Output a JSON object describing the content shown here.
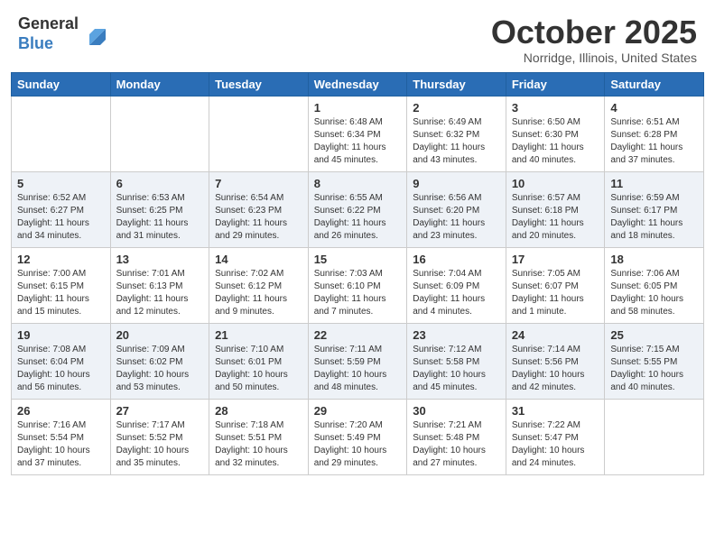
{
  "header": {
    "logo_line1": "General",
    "logo_line2": "Blue",
    "month": "October 2025",
    "location": "Norridge, Illinois, United States"
  },
  "days_of_week": [
    "Sunday",
    "Monday",
    "Tuesday",
    "Wednesday",
    "Thursday",
    "Friday",
    "Saturday"
  ],
  "weeks": [
    {
      "shaded": false,
      "days": [
        {
          "num": "",
          "info": ""
        },
        {
          "num": "",
          "info": ""
        },
        {
          "num": "",
          "info": ""
        },
        {
          "num": "1",
          "info": "Sunrise: 6:48 AM\nSunset: 6:34 PM\nDaylight: 11 hours and 45 minutes."
        },
        {
          "num": "2",
          "info": "Sunrise: 6:49 AM\nSunset: 6:32 PM\nDaylight: 11 hours and 43 minutes."
        },
        {
          "num": "3",
          "info": "Sunrise: 6:50 AM\nSunset: 6:30 PM\nDaylight: 11 hours and 40 minutes."
        },
        {
          "num": "4",
          "info": "Sunrise: 6:51 AM\nSunset: 6:28 PM\nDaylight: 11 hours and 37 minutes."
        }
      ]
    },
    {
      "shaded": true,
      "days": [
        {
          "num": "5",
          "info": "Sunrise: 6:52 AM\nSunset: 6:27 PM\nDaylight: 11 hours and 34 minutes."
        },
        {
          "num": "6",
          "info": "Sunrise: 6:53 AM\nSunset: 6:25 PM\nDaylight: 11 hours and 31 minutes."
        },
        {
          "num": "7",
          "info": "Sunrise: 6:54 AM\nSunset: 6:23 PM\nDaylight: 11 hours and 29 minutes."
        },
        {
          "num": "8",
          "info": "Sunrise: 6:55 AM\nSunset: 6:22 PM\nDaylight: 11 hours and 26 minutes."
        },
        {
          "num": "9",
          "info": "Sunrise: 6:56 AM\nSunset: 6:20 PM\nDaylight: 11 hours and 23 minutes."
        },
        {
          "num": "10",
          "info": "Sunrise: 6:57 AM\nSunset: 6:18 PM\nDaylight: 11 hours and 20 minutes."
        },
        {
          "num": "11",
          "info": "Sunrise: 6:59 AM\nSunset: 6:17 PM\nDaylight: 11 hours and 18 minutes."
        }
      ]
    },
    {
      "shaded": false,
      "days": [
        {
          "num": "12",
          "info": "Sunrise: 7:00 AM\nSunset: 6:15 PM\nDaylight: 11 hours and 15 minutes."
        },
        {
          "num": "13",
          "info": "Sunrise: 7:01 AM\nSunset: 6:13 PM\nDaylight: 11 hours and 12 minutes."
        },
        {
          "num": "14",
          "info": "Sunrise: 7:02 AM\nSunset: 6:12 PM\nDaylight: 11 hours and 9 minutes."
        },
        {
          "num": "15",
          "info": "Sunrise: 7:03 AM\nSunset: 6:10 PM\nDaylight: 11 hours and 7 minutes."
        },
        {
          "num": "16",
          "info": "Sunrise: 7:04 AM\nSunset: 6:09 PM\nDaylight: 11 hours and 4 minutes."
        },
        {
          "num": "17",
          "info": "Sunrise: 7:05 AM\nSunset: 6:07 PM\nDaylight: 11 hours and 1 minute."
        },
        {
          "num": "18",
          "info": "Sunrise: 7:06 AM\nSunset: 6:05 PM\nDaylight: 10 hours and 58 minutes."
        }
      ]
    },
    {
      "shaded": true,
      "days": [
        {
          "num": "19",
          "info": "Sunrise: 7:08 AM\nSunset: 6:04 PM\nDaylight: 10 hours and 56 minutes."
        },
        {
          "num": "20",
          "info": "Sunrise: 7:09 AM\nSunset: 6:02 PM\nDaylight: 10 hours and 53 minutes."
        },
        {
          "num": "21",
          "info": "Sunrise: 7:10 AM\nSunset: 6:01 PM\nDaylight: 10 hours and 50 minutes."
        },
        {
          "num": "22",
          "info": "Sunrise: 7:11 AM\nSunset: 5:59 PM\nDaylight: 10 hours and 48 minutes."
        },
        {
          "num": "23",
          "info": "Sunrise: 7:12 AM\nSunset: 5:58 PM\nDaylight: 10 hours and 45 minutes."
        },
        {
          "num": "24",
          "info": "Sunrise: 7:14 AM\nSunset: 5:56 PM\nDaylight: 10 hours and 42 minutes."
        },
        {
          "num": "25",
          "info": "Sunrise: 7:15 AM\nSunset: 5:55 PM\nDaylight: 10 hours and 40 minutes."
        }
      ]
    },
    {
      "shaded": false,
      "days": [
        {
          "num": "26",
          "info": "Sunrise: 7:16 AM\nSunset: 5:54 PM\nDaylight: 10 hours and 37 minutes."
        },
        {
          "num": "27",
          "info": "Sunrise: 7:17 AM\nSunset: 5:52 PM\nDaylight: 10 hours and 35 minutes."
        },
        {
          "num": "28",
          "info": "Sunrise: 7:18 AM\nSunset: 5:51 PM\nDaylight: 10 hours and 32 minutes."
        },
        {
          "num": "29",
          "info": "Sunrise: 7:20 AM\nSunset: 5:49 PM\nDaylight: 10 hours and 29 minutes."
        },
        {
          "num": "30",
          "info": "Sunrise: 7:21 AM\nSunset: 5:48 PM\nDaylight: 10 hours and 27 minutes."
        },
        {
          "num": "31",
          "info": "Sunrise: 7:22 AM\nSunset: 5:47 PM\nDaylight: 10 hours and 24 minutes."
        },
        {
          "num": "",
          "info": ""
        }
      ]
    }
  ]
}
